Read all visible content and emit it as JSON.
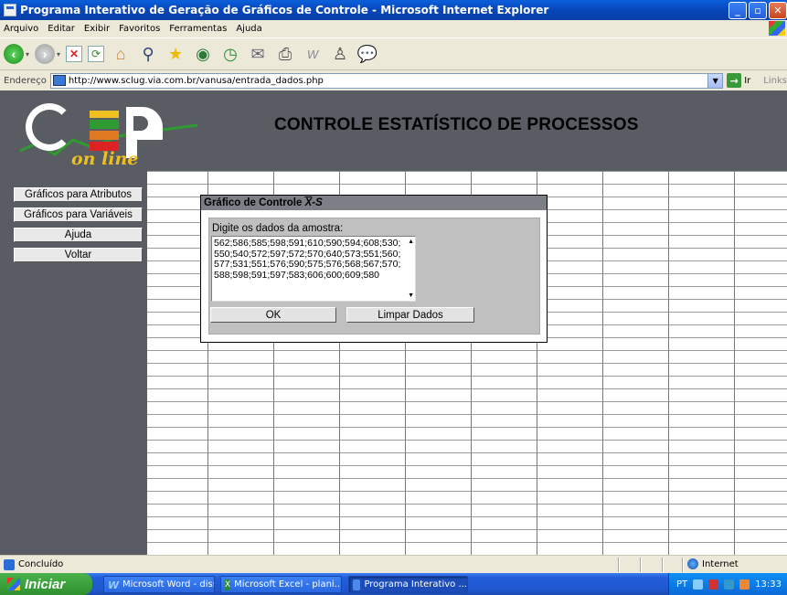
{
  "window": {
    "title": "Programa Interativo de Geração de Gráficos de Controle - Microsoft Internet Explorer",
    "minimize": "_",
    "maximize": "▫"
  },
  "menu": {
    "items": [
      "Arquivo",
      "Editar",
      "Exibir",
      "Favoritos",
      "Ferramentas",
      "Ajuda"
    ]
  },
  "address": {
    "label": "Endereço",
    "url": "http://www.sclug.via.com.br/vanusa/entrada_dados.php",
    "go_label": "Ir",
    "links_label": "Links"
  },
  "banner": {
    "title": "CONTROLE ESTATÍSTICO DE PROCESSOS",
    "logo_script": "on line"
  },
  "sidebar": {
    "items": [
      {
        "label": "Gráficos para Atributos"
      },
      {
        "label": "Gráficos para Variáveis"
      },
      {
        "label": "Ajuda"
      },
      {
        "label": "Voltar"
      }
    ]
  },
  "dialog": {
    "title_prefix": "Gráfico de Controle ",
    "title_xbar": "X",
    "title_sep": "-",
    "title_s": "S",
    "prompt": "Digite os dados da amostra:",
    "sample_data": "562;586;585;598;591;610;590;594;608;530;550;540;572;597;572;570;640;573;551;560;577;531;551;576;590;575;576;568;567;570;588;598;591;597;583;606;600;609;580",
    "ok_label": "OK",
    "clear_label": "Limpar Dados"
  },
  "status": {
    "text": "Concluído",
    "zone": "Internet"
  },
  "taskbar": {
    "start_label": "Iniciar",
    "tasks": [
      {
        "label": "Microsoft Word - diss..."
      },
      {
        "label": "Microsoft Excel - plani..."
      },
      {
        "label": "Programa Interativo ..."
      }
    ],
    "tray_lang": "PT",
    "clock": "13:33"
  },
  "colors": {
    "banner_bg": "#595c63",
    "dialog_title_bg": "#7c7f85",
    "dialog_body_bg": "#c0c0c0",
    "taskbar_blue": "#245edb",
    "start_green": "#2f8f2f"
  }
}
